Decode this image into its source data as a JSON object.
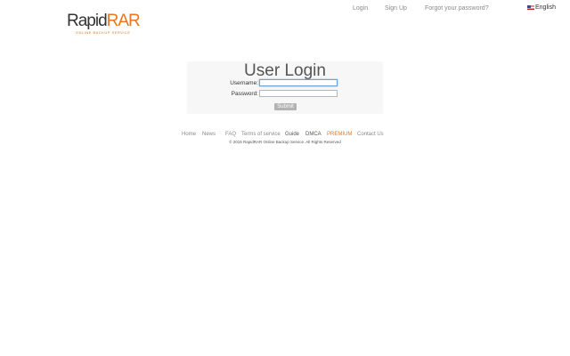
{
  "logo": {
    "rapid": "Rapid",
    "rar": "RAR",
    "tagline": "ONLINE BACKUP SERVICE",
    "accent_color": "#e8761f"
  },
  "topnav": {
    "login": "Login",
    "signup": "Sign Up",
    "forgot": "Forgot your password?"
  },
  "language": {
    "label": "English",
    "flag_icon": "us-flag-icon"
  },
  "login": {
    "title": "User Login",
    "username_label": "Username:",
    "username_value": "",
    "password_label": "Password:",
    "password_value": "",
    "submit_label": "Submit"
  },
  "footer": {
    "links": {
      "home": "Home",
      "news": "News",
      "faq": "FAQ",
      "terms": "Terms of service",
      "guide": "Guide",
      "dmca": "DMCA",
      "premium": "PREMIUM",
      "contact": "Contact Us"
    },
    "copyright": "© 2015 RapidRAR Online Backup Service. All Rights Reserved"
  }
}
